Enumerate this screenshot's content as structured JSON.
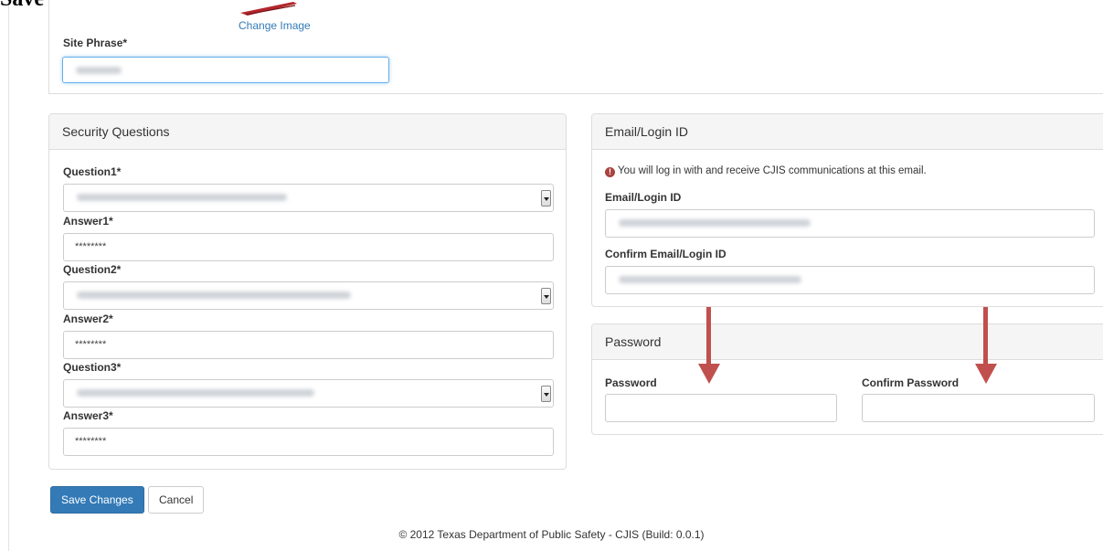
{
  "caption": "Save Changes.",
  "site": {
    "change_image": "Change Image",
    "phrase_label": "Site Phrase*"
  },
  "security": {
    "heading": "Security Questions",
    "question1_label": "Question1*",
    "answer1_label": "Answer1*",
    "answer1_value": "********",
    "question2_label": "Question2*",
    "answer2_label": "Answer2*",
    "answer2_value": "********",
    "question3_label": "Question3*",
    "answer3_label": "Answer3*",
    "answer3_value": "********"
  },
  "email": {
    "heading": "Email/Login ID",
    "info": "You will log in with and receive CJIS communications at this email.",
    "info_icon": "exclamation-circle-icon",
    "email_label": "Email/Login ID",
    "confirm_label": "Confirm Email/Login ID"
  },
  "password": {
    "heading": "Password",
    "password_label": "Password",
    "confirm_label": "Confirm Password"
  },
  "actions": {
    "save": "Save Changes",
    "cancel": "Cancel"
  },
  "footer": "© 2012 Texas Department of Public Safety - CJIS (Build: 0.0.1)",
  "colors": {
    "primary": "#337ab7",
    "annotation_arrow": "#c0504d",
    "info_icon": "#a94442"
  }
}
